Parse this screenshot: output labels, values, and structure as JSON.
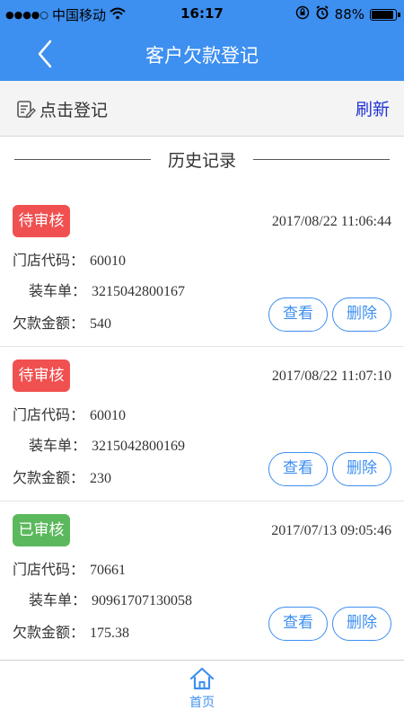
{
  "statusbar": {
    "carrier": "中国移动",
    "time": "16:17",
    "battery": "88%"
  },
  "header": {
    "title": "客户欠款登记"
  },
  "toolbar": {
    "register_label": "点击登记",
    "refresh_label": "刷新"
  },
  "section": {
    "title": "历史记录"
  },
  "labels": {
    "store_code": "门店代码：",
    "loading_no": "装车单：",
    "amount": "欠款金额：",
    "view": "查看",
    "delete": "删除"
  },
  "records": [
    {
      "status": "待审核",
      "status_color": "#f05050",
      "time": "2017/08/22 11:06:44",
      "store_code": "60010",
      "loading_no": "3215042800167",
      "amount": "540"
    },
    {
      "status": "待审核",
      "status_color": "#f05050",
      "time": "2017/08/22 11:07:10",
      "store_code": "60010",
      "loading_no": "3215042800169",
      "amount": "230"
    },
    {
      "status": "已审核",
      "status_color": "#5cb85c",
      "time": "2017/07/13 09:05:46",
      "store_code": "70661",
      "loading_no": "90961707130058",
      "amount": "175.38"
    }
  ],
  "tabbar": {
    "home_label": "首页"
  },
  "colors": {
    "primary": "#3d8ff0",
    "refresh": "#2333d6"
  }
}
